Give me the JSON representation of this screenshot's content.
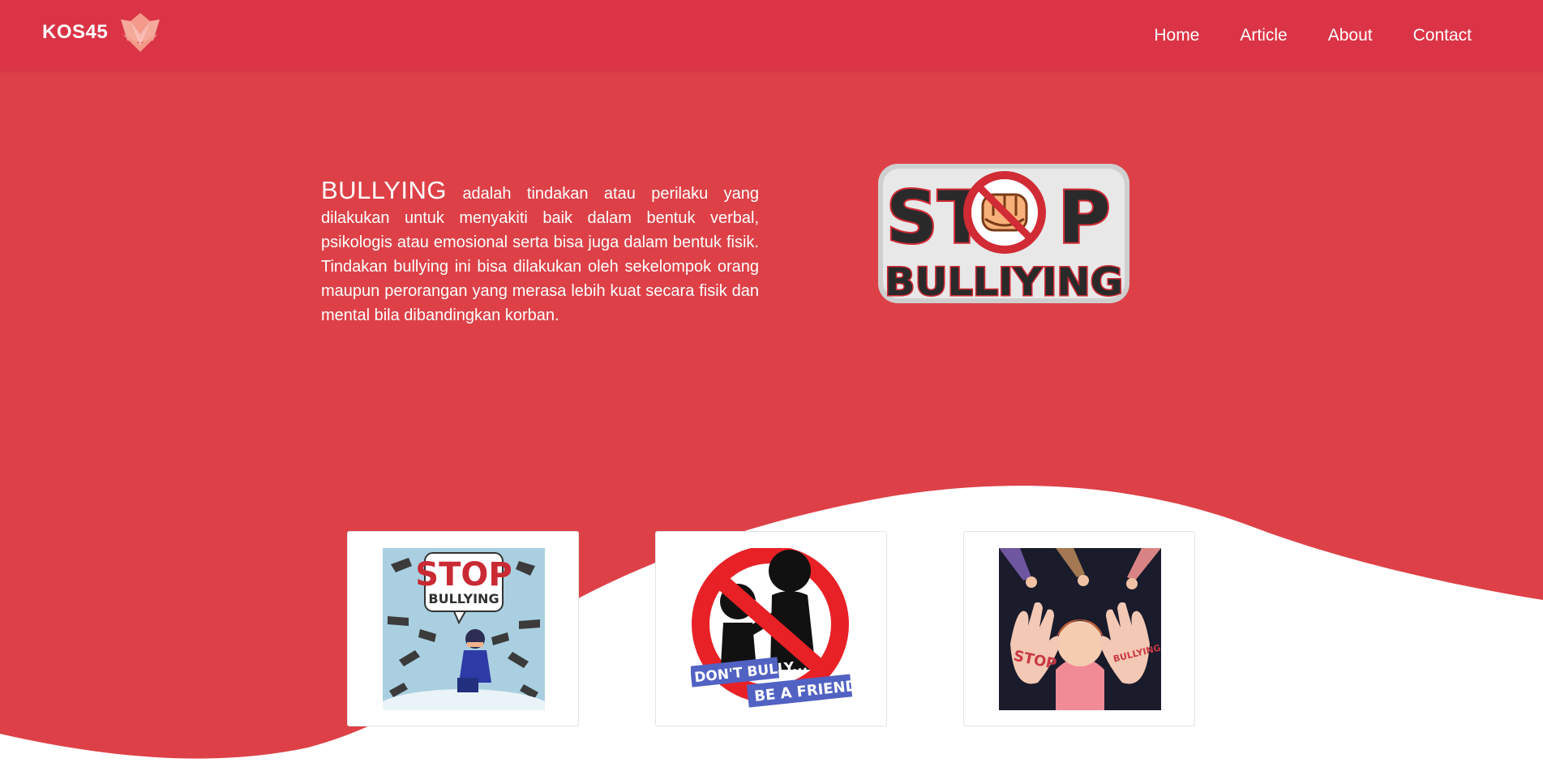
{
  "brand": {
    "name": "KOS45",
    "logo_icon": "lotus-icon"
  },
  "nav": {
    "items": [
      {
        "label": "Home"
      },
      {
        "label": "Article"
      },
      {
        "label": "About"
      },
      {
        "label": "Contact"
      }
    ]
  },
  "intro": {
    "lead": "BULLYING",
    "body": "adalah tindakan atau perilaku yang dilakukan untuk menyakiti baik dalam bentuk verbal, psikologis atau emosional serta bisa juga dalam bentuk fisik. Tindakan bullying ini bisa dilakukan oleh sekelompok orang maupun perorangan yang merasa lebih kuat secara fisik dan mental bila dibandingkan korban."
  },
  "hero_logo": {
    "line1_left": "ST",
    "line1_right": "P",
    "line2": "BULLIYING"
  },
  "cards": [
    {
      "name": "stop-bullying-card",
      "line1": "STOP",
      "line2": "BULLYING"
    },
    {
      "name": "dont-bully-card",
      "line1": "DON'T BULLY...",
      "line2": "BE A FRIEND."
    },
    {
      "name": "stop-hands-card",
      "left_hand": "STOP",
      "right_hand": "BULLYING"
    }
  ],
  "colors": {
    "navbar": "#db3446",
    "hero": "#dd4147",
    "white": "#ffffff"
  }
}
